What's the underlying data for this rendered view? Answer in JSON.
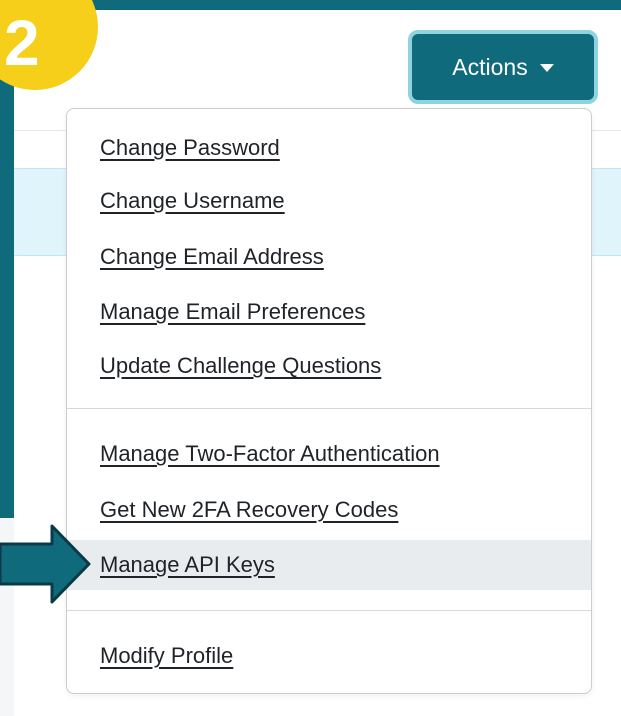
{
  "badge": {
    "number": "2"
  },
  "actions_button": {
    "label": "Actions"
  },
  "menu": {
    "group1": [
      "Change Password",
      "Change Username",
      "Change Email Address",
      "Manage Email Preferences",
      "Update Challenge Questions"
    ],
    "group2": [
      "Manage Two-Factor Authentication",
      "Get New 2FA Recovery Codes",
      "Manage API Keys"
    ],
    "group3": [
      "Modify Profile"
    ],
    "highlighted_item": "Manage API Keys"
  },
  "colors": {
    "teal": "#0f6a7b",
    "badge_yellow": "#f6cf1a",
    "info_band": "#dff4fb"
  },
  "icons": {
    "dropdown": "caret-down-icon",
    "pointer": "arrow-right-icon"
  }
}
